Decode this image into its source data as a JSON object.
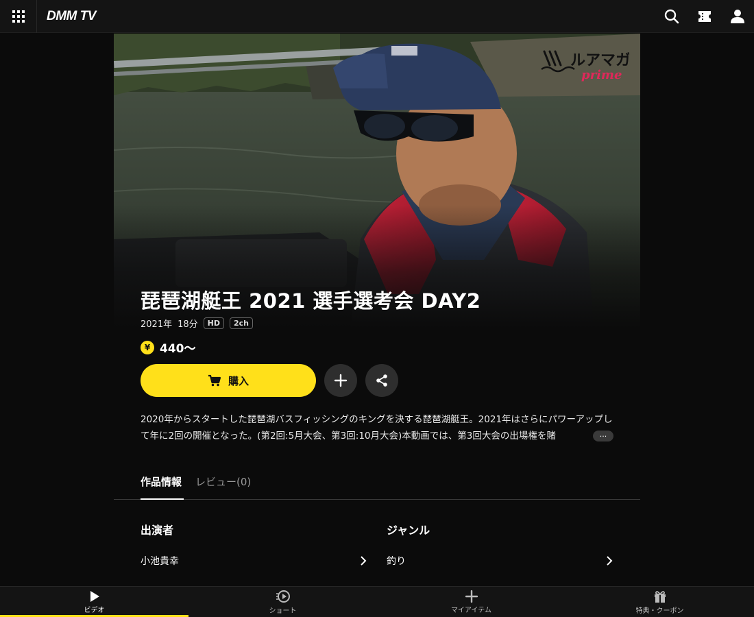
{
  "header": {
    "logo": "DMM TV",
    "icons": [
      "grid-menu-icon",
      "search-icon",
      "ticket-icon",
      "account-icon"
    ]
  },
  "hero": {
    "brand_logo_top": "ルアマガ",
    "brand_logo_bottom": "prime"
  },
  "title": "琵琶湖艇王 2021 選手選考会 DAY2",
  "meta": {
    "year": "2021年",
    "duration": "18分",
    "badges": [
      "HD",
      "2ch"
    ]
  },
  "price": {
    "icon": "¥",
    "value": "440～"
  },
  "actions": {
    "buy_label": "購入",
    "add_icon": "plus-icon",
    "share_icon": "share-icon"
  },
  "description": "2020年からスタートした琵琶湖バスフィッシングのキングを決する琵琶湖艇王。2021年はさらにパワーアップして年に2回の開催となった。(第2回:5月大会、第3回:10月大会)本動画では、第3回大会の出場権を賭",
  "more_label": "···",
  "tabs": [
    {
      "label": "作品情報",
      "active": true
    },
    {
      "label": "レビュー(0)",
      "active": false
    }
  ],
  "info": {
    "cast": {
      "heading": "出演者",
      "value": "小池貴幸"
    },
    "genre": {
      "heading": "ジャンル",
      "value": "釣り"
    }
  },
  "bottom_nav": [
    {
      "label": "ビデオ",
      "icon": "play-icon",
      "active": true
    },
    {
      "label": "ショート",
      "icon": "short-video-icon",
      "active": false
    },
    {
      "label": "マイアイテム",
      "icon": "plus-icon",
      "active": false
    },
    {
      "label": "特典・クーポン",
      "icon": "gift-icon",
      "active": false
    }
  ],
  "colors": {
    "accent": "#ffe01a",
    "background": "#0b0b0b",
    "header": "#141414"
  }
}
